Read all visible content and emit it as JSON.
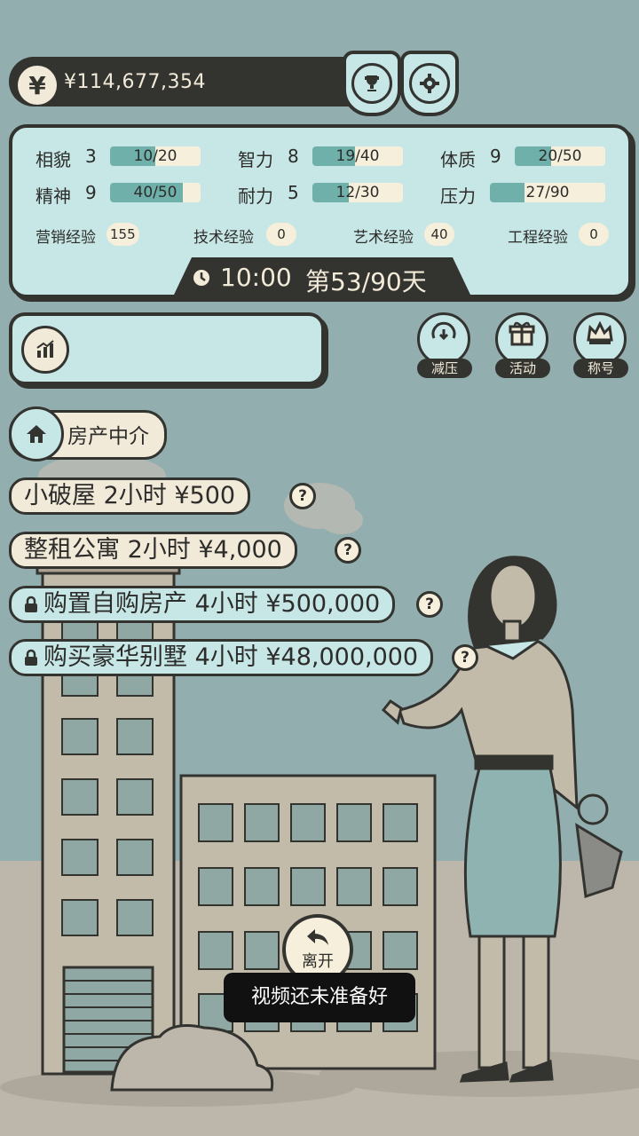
{
  "header": {
    "currency_symbol": "¥",
    "money": "¥114,677,354",
    "trophy_icon": "trophy-icon",
    "settings_icon": "gear-icon"
  },
  "stats": {
    "rows": [
      [
        {
          "label": "相貌",
          "level": "3",
          "bar": "10/20",
          "fill": 0.5
        },
        {
          "label": "智力",
          "level": "8",
          "bar": "19/40",
          "fill": 0.475
        },
        {
          "label": "体质",
          "level": "9",
          "bar": "20/50",
          "fill": 0.4
        }
      ],
      [
        {
          "label": "精神",
          "level": "9",
          "bar": "40/50",
          "fill": 0.8
        },
        {
          "label": "耐力",
          "level": "5",
          "bar": "12/30",
          "fill": 0.4
        },
        {
          "label": "压力",
          "level": "",
          "bar": "27/90",
          "fill": 0.3
        }
      ]
    ],
    "experience": [
      {
        "label": "营销经验",
        "value": "155"
      },
      {
        "label": "技术经验",
        "value": "0"
      },
      {
        "label": "艺术经验",
        "value": "40"
      },
      {
        "label": "工程经验",
        "value": "0"
      }
    ],
    "time": "10:00",
    "day": "第53/90天"
  },
  "actions": {
    "stress": "减压",
    "event": "活动",
    "title": "称号"
  },
  "location": {
    "name": "房产中介"
  },
  "options": [
    {
      "text": "小破屋 2小时 ¥500",
      "locked": false
    },
    {
      "text": "整租公寓 2小时 ¥4,000",
      "locked": false
    },
    {
      "text": "购置自购房产 4小时 ¥500,000",
      "locked": true
    },
    {
      "text": "购买豪华别墅 4小时 ¥48,000,000",
      "locked": true
    }
  ],
  "help_symbol": "?",
  "leave_label": "离开",
  "toast": "视频还未准备好",
  "colors": {
    "background": "#93aeae",
    "panel": "#c7e6e6",
    "cream": "#f2ead8",
    "dark": "#333330",
    "bar_fill": "#6fb0ab"
  }
}
